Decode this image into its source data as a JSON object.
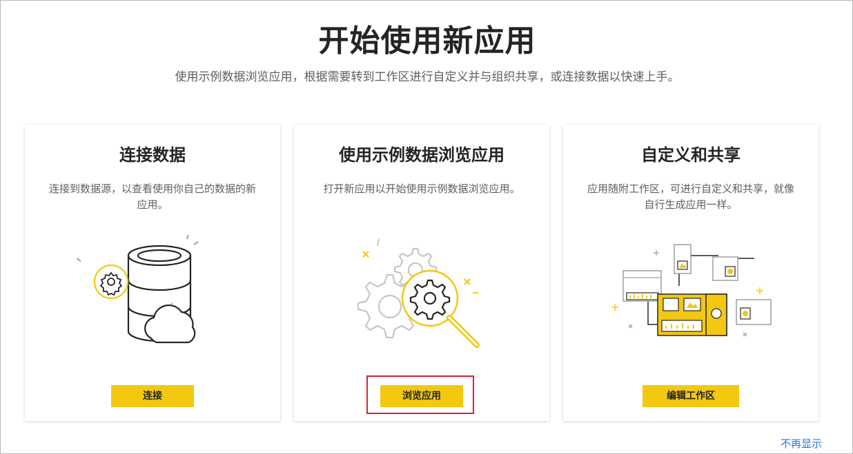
{
  "header": {
    "title": "开始使用新应用",
    "subtitle": "使用示例数据浏览应用，根据需要转到工作区进行自定义并与组织共享，或连接数据以快速上手。"
  },
  "cards": [
    {
      "title": "连接数据",
      "description": "连接到数据源，以查看使用你自己的数据的新应用。",
      "button": "连接",
      "illustration": "database-cloud-icon"
    },
    {
      "title": "使用示例数据浏览应用",
      "description": "打开新应用以开始使用示例数据浏览应用。",
      "button": "浏览应用",
      "illustration": "gear-magnifier-icon",
      "highlighted": true
    },
    {
      "title": "自定义和共享",
      "description": "应用随附工作区，可进行自定义和共享，就像自行生成应用一样。",
      "button": "编辑工作区",
      "illustration": "dashboard-workspace-icon"
    }
  ],
  "footer": {
    "dont_show_label": "不再显示"
  },
  "colors": {
    "accent_yellow": "#f2c811",
    "highlight_red": "#d6203a",
    "link_blue": "#2a74d5"
  }
}
